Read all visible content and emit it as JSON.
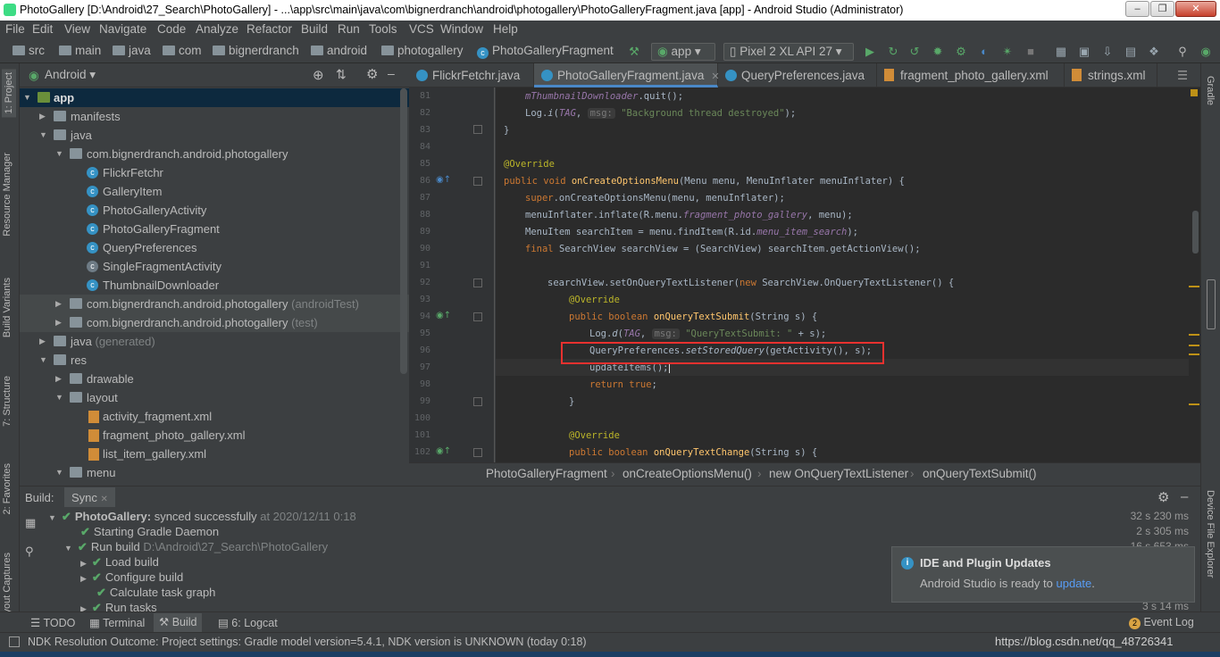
{
  "window": {
    "title": "PhotoGallery [D:\\Android\\27_Search\\PhotoGallery] - ...\\app\\src\\main\\java\\com\\bignerdranch\\android\\photogallery\\PhotoGalleryFragment.java [app] - Android Studio (Administrator)"
  },
  "menu": [
    "File",
    "Edit",
    "View",
    "Navigate",
    "Code",
    "Analyze",
    "Refactor",
    "Build",
    "Run",
    "Tools",
    "VCS",
    "Window",
    "Help"
  ],
  "nav": {
    "crumbs": [
      "src",
      "main",
      "java",
      "com",
      "bignerdranch",
      "android",
      "photogallery",
      "PhotoGalleryFragment"
    ],
    "run_config": "app",
    "device": "Pixel 2 XL API 27"
  },
  "left_strip": {
    "project": "1: Project",
    "resource_manager": "Resource Manager",
    "build_variants": "Build Variants",
    "structure": "7: Structure",
    "favorites": "2: Favorites",
    "captures": "Layout Captures"
  },
  "right_strip": {
    "gradle": "Gradle",
    "device_explorer": "Device File Explorer"
  },
  "project": {
    "view": "Android",
    "tree": [
      {
        "label": "app",
        "suffix": ""
      },
      {
        "label": "manifests",
        "suffix": ""
      },
      {
        "label": "java",
        "suffix": ""
      },
      {
        "label": "com.bignerdranch.android.photogallery",
        "suffix": ""
      },
      {
        "label": "FlickrFetchr",
        "suffix": ""
      },
      {
        "label": "GalleryItem",
        "suffix": ""
      },
      {
        "label": "PhotoGalleryActivity",
        "suffix": ""
      },
      {
        "label": "PhotoGalleryFragment",
        "suffix": ""
      },
      {
        "label": "QueryPreferences",
        "suffix": ""
      },
      {
        "label": "SingleFragmentActivity",
        "suffix": ""
      },
      {
        "label": "ThumbnailDownloader",
        "suffix": ""
      },
      {
        "label": "com.bignerdranch.android.photogallery",
        "suffix": "(androidTest)"
      },
      {
        "label": "com.bignerdranch.android.photogallery",
        "suffix": "(test)"
      },
      {
        "label": "java",
        "suffix": "(generated)"
      },
      {
        "label": "res",
        "suffix": ""
      },
      {
        "label": "drawable",
        "suffix": ""
      },
      {
        "label": "layout",
        "suffix": ""
      },
      {
        "label": "activity_fragment.xml",
        "suffix": ""
      },
      {
        "label": "fragment_photo_gallery.xml",
        "suffix": ""
      },
      {
        "label": "list_item_gallery.xml",
        "suffix": ""
      },
      {
        "label": "menu",
        "suffix": ""
      }
    ]
  },
  "tabs": [
    "FlickrFetchr.java",
    "PhotoGalleryFragment.java",
    "QueryPreferences.java",
    "fragment_photo_gallery.xml",
    "strings.xml"
  ],
  "editor": {
    "line_numbers": [
      "81",
      "82",
      "83",
      "84",
      "85",
      "86",
      "87",
      "88",
      "89",
      "90",
      "91",
      "92",
      "93",
      "94",
      "95",
      "96",
      "97",
      "98",
      "99",
      "100",
      "101",
      "102"
    ],
    "param_hint": "msg:"
  },
  "breadcrumb": [
    "PhotoGalleryFragment",
    "onCreateOptionsMenu()",
    "new OnQueryTextListener",
    "onQueryTextSubmit()"
  ],
  "build": {
    "tab_build": "Build:",
    "tab_sync": "Sync",
    "rows": [
      {
        "bold": "PhotoGallery:",
        "text": "synced successfully",
        "extra": "at 2020/12/11 0:18",
        "time": "32 s 230 ms"
      },
      {
        "bold": "",
        "text": "Starting Gradle Daemon",
        "extra": "",
        "time": "2 s 305 ms"
      },
      {
        "bold": "",
        "text": "Run build",
        "extra": "D:\\Android\\27_Search\\PhotoGallery",
        "time": "16 s 653 ms"
      },
      {
        "bold": "",
        "text": "Load build",
        "extra": "",
        "time": ""
      },
      {
        "bold": "",
        "text": "Configure build",
        "extra": "",
        "time": ""
      },
      {
        "bold": "",
        "text": "Calculate task graph",
        "extra": "",
        "time": ""
      },
      {
        "bold": "",
        "text": "Run tasks",
        "extra": "",
        "time": "3 s 14 ms"
      }
    ]
  },
  "notification": {
    "title": "IDE and Plugin Updates",
    "body": "Android Studio is ready to",
    "link": "update",
    "end": "."
  },
  "bottom_tabs": {
    "todo": "TODO",
    "terminal": "Terminal",
    "build": "Build",
    "logcat": "6: Logcat",
    "event_log": "Event Log",
    "event_count": "2"
  },
  "status": {
    "text": "NDK Resolution Outcome: Project settings: Gradle model version=5.4.1, NDK version is UNKNOWN (today 0:18)",
    "watermark": "https://blog.csdn.net/qq_48726341"
  },
  "colors": {
    "accent": "#4a88c7",
    "highlight_box": "#e8312f",
    "success": "#59a869"
  }
}
